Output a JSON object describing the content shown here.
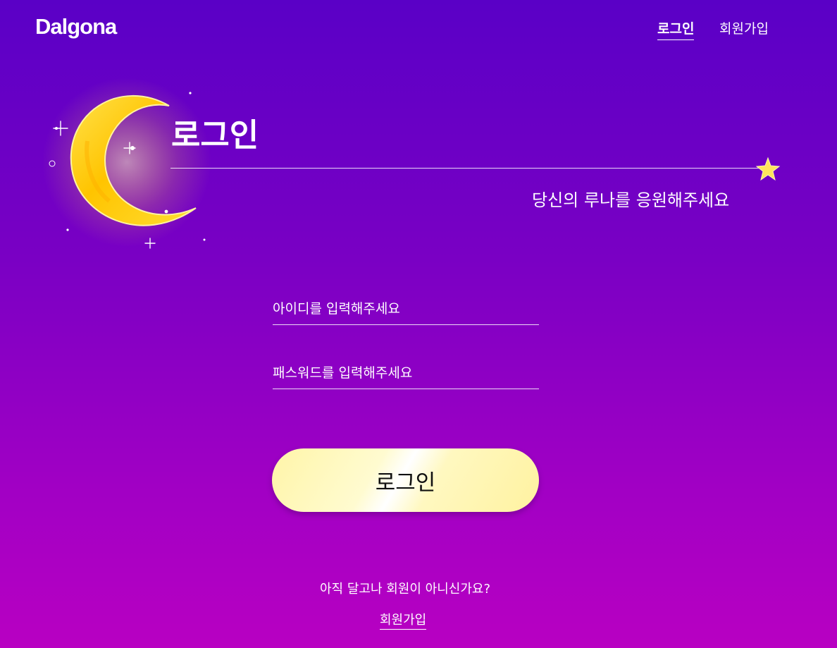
{
  "brand": {
    "logo_text": "Dalgona"
  },
  "nav": {
    "login_label": "로그인",
    "signup_label": "회원가입"
  },
  "hero": {
    "title": "로그인",
    "subtitle": "당신의 루나를 응원해주세요"
  },
  "form": {
    "id_placeholder": "아이디를 입력해주세요",
    "id_value": "",
    "password_placeholder": "패스워드를 입력해주세요",
    "password_value": "",
    "submit_label": "로그인"
  },
  "footer": {
    "prompt": "아직 달고나 회원이 아니신가요?",
    "signup_link": "회원가입"
  },
  "icons": {
    "moon": "crescent-moon-icon",
    "star": "star-icon"
  },
  "colors": {
    "background_top": "#5a00c6",
    "background_bottom": "#b800c2",
    "button_fill": "#fff5a8",
    "moon": "#ffd400",
    "text": "#ffffff"
  }
}
